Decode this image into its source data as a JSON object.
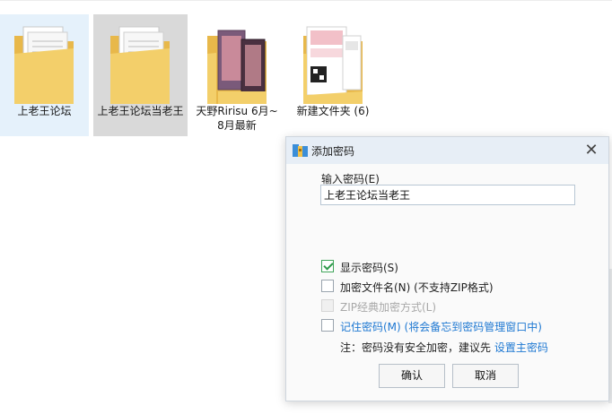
{
  "explorer": {
    "items": [
      {
        "label": "上老王论坛",
        "type": "folder-docs",
        "state": "hover"
      },
      {
        "label": "上老王论坛当老王",
        "type": "folder-docs",
        "state": "selected"
      },
      {
        "label": "天野Ririsu 6月~8月最新",
        "type": "folder-photos",
        "state": "normal"
      },
      {
        "label": "新建文件夹 (6)",
        "type": "folder-mixed",
        "state": "normal"
      }
    ]
  },
  "dialog": {
    "title": "添加密码",
    "password_label": "输入密码(E)",
    "password_value": "上老王论坛当老王",
    "options": [
      {
        "label": "显示密码(S)",
        "checked": true,
        "disabled": false,
        "link": false
      },
      {
        "label": "加密文件名(N) (不支持ZIP格式)",
        "checked": false,
        "disabled": false,
        "link": false
      },
      {
        "label": "ZIP经典加密方式(L)",
        "checked": false,
        "disabled": true,
        "link": false
      },
      {
        "label": "记住密码(M) (将会备忘到密码管理窗口中)",
        "checked": false,
        "disabled": false,
        "link": true
      }
    ],
    "note_prefix": "注：密码没有安全加密，建议先 ",
    "note_link": "设置主密码",
    "ok_label": "确认",
    "cancel_label": "取消"
  },
  "colors": {
    "selection": "#d9d9d9",
    "hover": "#e5f1fb",
    "link": "#1e78d2",
    "check": "#2f9a4a",
    "titlebar": "#e7eef6"
  }
}
